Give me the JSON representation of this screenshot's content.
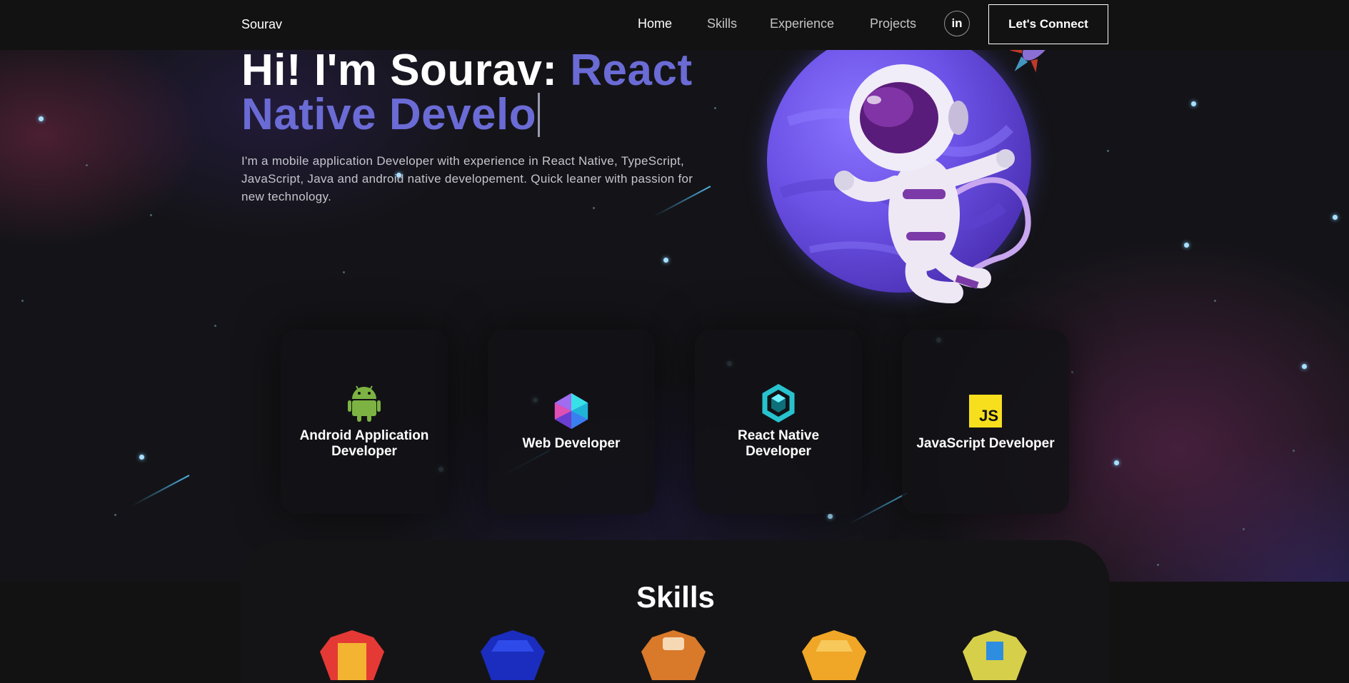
{
  "navbar": {
    "brand": "Sourav",
    "links": [
      {
        "label": "Home",
        "active": true
      },
      {
        "label": "Skills",
        "active": false
      },
      {
        "label": "Experience",
        "active": false
      },
      {
        "label": "Projects",
        "active": false
      }
    ],
    "social_label": "in",
    "connect_label": "Let's Connect"
  },
  "hero": {
    "greeting": "Hi! I'm Sourav:",
    "typed_role": "React Native Develo",
    "description": "I'm a mobile application Developer with experience in React Native, TypeScript, JavaScript, Java and android native developement. Quick leaner with passion for new technology.",
    "illustration": "astronaut-planet-rocket"
  },
  "services": [
    {
      "title": "Android Application Developer",
      "icon": "android-icon"
    },
    {
      "title": "Web Developer",
      "icon": "gem-icon"
    },
    {
      "title": "React Native Developer",
      "icon": "react-native-icon"
    },
    {
      "title": "JavaScript Developer",
      "icon": "javascript-icon",
      "badge": "JS"
    }
  ],
  "skills": {
    "title": "Skills",
    "icons": [
      "red-cube-icon",
      "blue-cube-icon",
      "orange-cube-icon",
      "yellow-cube-icon",
      "lime-cube-icon"
    ]
  },
  "colors": {
    "accent": "#6b6bd6",
    "background": "#121212",
    "star": "#a8e0ff",
    "js_yellow": "#f7df1e",
    "android_green": "#7cb342"
  }
}
